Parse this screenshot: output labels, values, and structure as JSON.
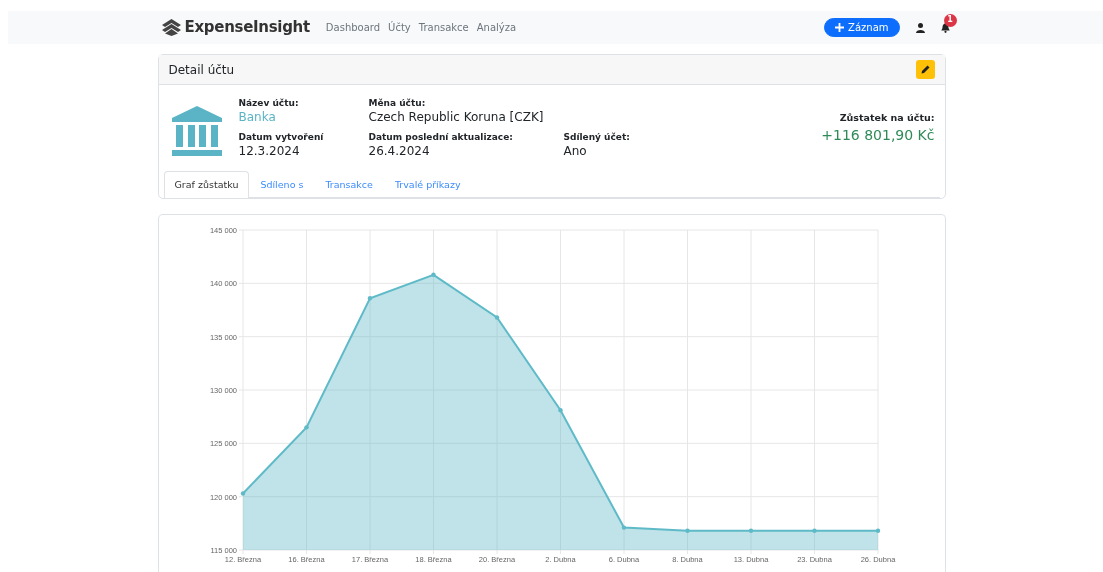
{
  "navbar": {
    "brand": "ExpenseInsight",
    "links": [
      {
        "label": "Dashboard",
        "selected": false
      },
      {
        "label": "Účty",
        "selected": false
      },
      {
        "label": "Transakce",
        "selected": false
      },
      {
        "label": "Analýza",
        "selected": false
      }
    ],
    "new_button": {
      "label": "Záznam"
    },
    "notifications": {
      "count": "1"
    }
  },
  "account_card": {
    "title": "Detail účtu",
    "rows": [
      [
        {
          "label": "Název účtu:",
          "value": "Banka",
          "kind": "name"
        },
        {
          "label": "Měna účtu:",
          "value": "Czech Republic Koruna [CZK]",
          "kind": "plain"
        }
      ],
      [
        {
          "label": "Datum vytvoření",
          "value": "12.3.2024",
          "kind": "plain"
        },
        {
          "label": "Datum poslední aktualizace:",
          "value": "26.4.2024",
          "kind": "plain"
        },
        {
          "label": "Sdílený účet:",
          "value": "Ano",
          "kind": "plain"
        }
      ]
    ],
    "balance": {
      "label": "Zůstatek na účtu:",
      "value": "+116 801,90 Kč"
    },
    "tabs": [
      {
        "label": "Graf zůstatku",
        "selected": true
      },
      {
        "label": "Sdíleno s",
        "selected": false
      },
      {
        "label": "Transakce",
        "selected": false
      },
      {
        "label": "Trvalé příkazy",
        "selected": false
      }
    ]
  },
  "chart_data": {
    "type": "area",
    "categories": [
      "12. Března",
      "16. Března",
      "17. Března",
      "18. Března",
      "20. Března",
      "2. Dubna",
      "6. Dubna",
      "8. Dubna",
      "13. Dubna",
      "23. Dubna",
      "26. Dubna"
    ],
    "series": [
      {
        "color": "#5fbac8",
        "values": [
          120300,
          126500,
          138600,
          140800,
          136800,
          128100,
          117100,
          116800,
          116800,
          116800,
          116800
        ]
      }
    ],
    "grid": true,
    "ylim": [
      115000,
      145000
    ],
    "yticks": [
      {
        "value": 115000,
        "label": "115 000"
      },
      {
        "value": 120000,
        "label": "120 000"
      },
      {
        "value": 125000,
        "label": "125 000"
      },
      {
        "value": 130000,
        "label": "130 000"
      },
      {
        "value": 135000,
        "label": "135 000"
      },
      {
        "value": 140000,
        "label": "140 000"
      },
      {
        "value": 145000,
        "label": "145 000"
      }
    ]
  }
}
